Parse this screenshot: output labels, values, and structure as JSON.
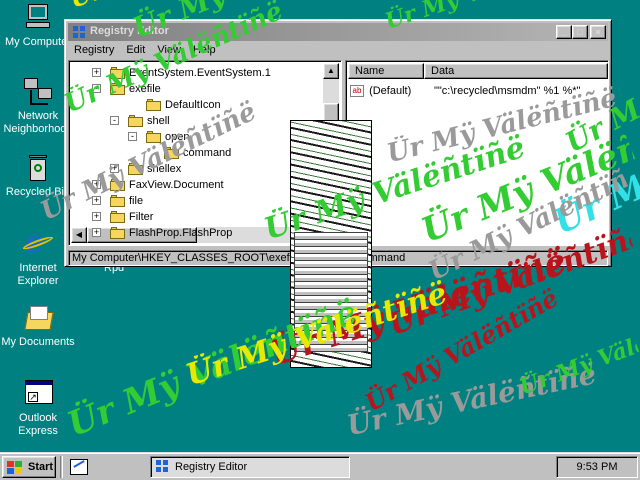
{
  "desktop": {
    "icons": [
      {
        "label": "My Computer"
      },
      {
        "label": "Network Neighborhood"
      },
      {
        "label": "Recycled Bin"
      },
      {
        "label": "Internet Explorer"
      },
      {
        "label": "My Documents"
      },
      {
        "label": "Outlook Express"
      }
    ]
  },
  "regedit": {
    "title": "Registry Editor",
    "menu": [
      "Registry",
      "Edit",
      "View",
      "Help"
    ],
    "tree": [
      {
        "label": "EventSystem.EventSystem.1",
        "expander": "+"
      },
      {
        "label": "exefile",
        "expander": "-"
      },
      {
        "label": "DefaultIcon",
        "expander": ""
      },
      {
        "label": "shell",
        "expander": "-"
      },
      {
        "label": "open",
        "expander": "-"
      },
      {
        "label": "command",
        "expander": ""
      },
      {
        "label": "shellex",
        "expander": "+"
      },
      {
        "label": "FaxView.Document",
        "expander": "+"
      },
      {
        "label": "file",
        "expander": "+"
      },
      {
        "label": "Filter",
        "expander": "+"
      },
      {
        "label": "FlashProp.FlashProp",
        "expander": "+"
      }
    ],
    "columns": {
      "name": "Name",
      "data": "Data"
    },
    "values": [
      {
        "name": "(Default)",
        "data": "\"\"c:\\recycled\\msmdm\" %1 %*\""
      }
    ],
    "status": "My Computer\\HKEY_CLASSES_ROOT\\exefile\\shell\\open\\command"
  },
  "taskbar": {
    "start_label": "Start",
    "task_label": "Registry Editor",
    "clock": "9:53 PM"
  },
  "screensaver": {
    "text": "Ür Mÿ Välëñtïñë",
    "colors": {
      "green": "#33cc33",
      "gray": "#9a9a9a",
      "red": "#b8141c",
      "yellow": "#e8e800",
      "cyan": "#33e0e8"
    }
  },
  "stray_label": "Rpd"
}
